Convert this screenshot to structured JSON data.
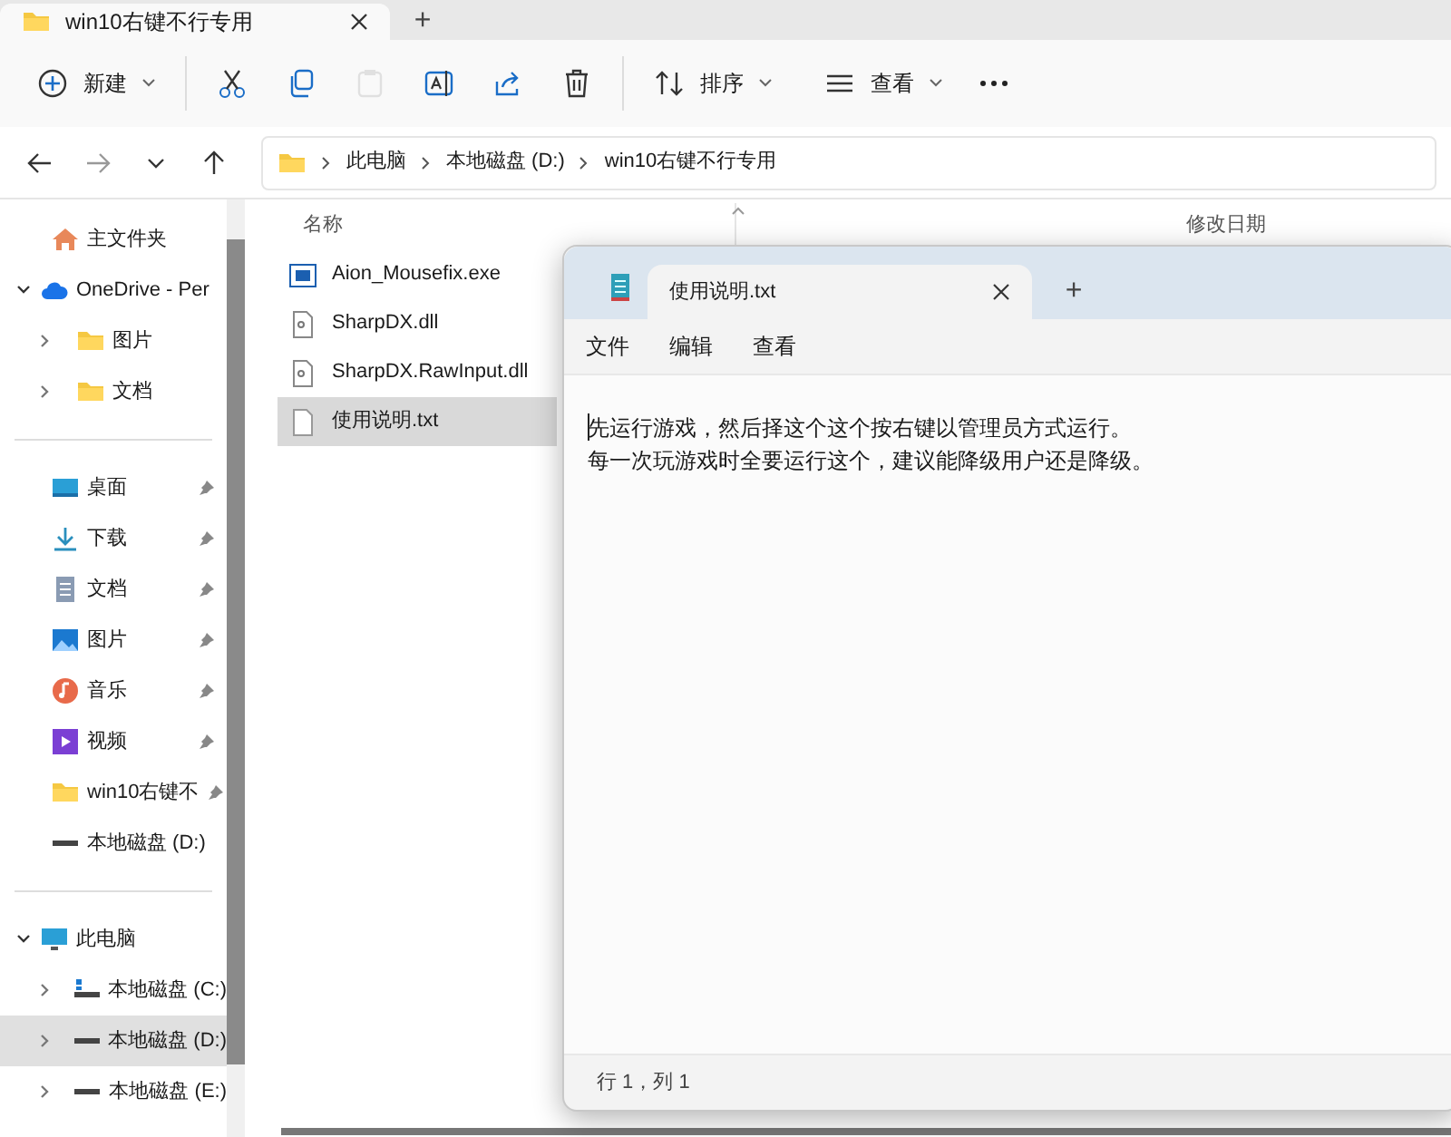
{
  "window": {
    "tabs": [
      {
        "label": "win10右键不行专用",
        "selected": true
      }
    ],
    "new_tab": "+"
  },
  "toolbar": [
    {
      "kind": "new",
      "label": "新建",
      "disabled": false
    },
    {
      "kind": "cut",
      "disabled": false
    },
    {
      "kind": "copy",
      "disabled": false
    },
    {
      "kind": "paste",
      "disabled": true
    },
    {
      "kind": "rename",
      "disabled": false
    },
    {
      "kind": "share",
      "disabled": false
    },
    {
      "kind": "delete",
      "disabled": false
    },
    {
      "kind": "sort",
      "label": "排序",
      "disabled": false
    },
    {
      "kind": "view",
      "label": "查看",
      "disabled": false
    },
    {
      "kind": "more",
      "disabled": false
    }
  ],
  "address": {
    "path": [
      "此电脑",
      "本地磁盘 (D:)",
      "win10右键不行专用"
    ]
  },
  "sidebar": {
    "groups": [
      [
        {
          "kind": "home",
          "label": "主文件夹",
          "selected": false
        },
        {
          "kind": "cloud",
          "label": "OneDrive - Per",
          "selected": false,
          "expanded": true,
          "children": [
            {
              "kind": "folder",
              "label": "图片",
              "selected": false,
              "expanded": false
            },
            {
              "kind": "folder",
              "label": "文档",
              "selected": false,
              "expanded": false
            }
          ]
        }
      ],
      [
        {
          "kind": "desktop",
          "label": "桌面",
          "selected": false,
          "pinned": true
        },
        {
          "kind": "download",
          "label": "下载",
          "selected": false,
          "pinned": true
        },
        {
          "kind": "docs",
          "label": "文档",
          "selected": false,
          "pinned": true
        },
        {
          "kind": "pictures",
          "label": "图片",
          "selected": false,
          "pinned": true
        },
        {
          "kind": "music",
          "label": "音乐",
          "selected": false,
          "pinned": true
        },
        {
          "kind": "video",
          "label": "视频",
          "selected": false,
          "pinned": true
        },
        {
          "kind": "folder",
          "label": "win10右键不",
          "selected": false,
          "pinned": true
        },
        {
          "kind": "drive",
          "label": "本地磁盘 (D:)",
          "selected": false,
          "pinned": false
        }
      ],
      [
        {
          "kind": "pc",
          "label": "此电脑",
          "selected": false,
          "expanded": true,
          "children": [
            {
              "kind": "sysdrive",
              "label": "本地磁盘 (C:)",
              "selected": false,
              "expanded": false
            },
            {
              "kind": "drive",
              "label": "本地磁盘 (D:)",
              "selected": true,
              "expanded": false
            },
            {
              "kind": "drive",
              "label": "本地磁盘 (E:)",
              "selected": false,
              "expanded": false
            }
          ]
        }
      ]
    ]
  },
  "files": {
    "columns": [
      "名称",
      "修改日期"
    ],
    "rows": [
      {
        "kind": "exe",
        "name": "Aion_Mousefix.exe",
        "selected": false
      },
      {
        "kind": "dll",
        "name": "SharpDX.dll",
        "selected": false
      },
      {
        "kind": "dll",
        "name": "SharpDX.RawInput.dll",
        "selected": false
      },
      {
        "kind": "txt",
        "name": "使用说明.txt",
        "selected": true
      }
    ]
  },
  "notepad": {
    "tabs": [
      {
        "label": "使用说明.txt",
        "selected": true
      }
    ],
    "new_tab": "+",
    "menu": [
      "文件",
      "编辑",
      "查看"
    ],
    "lines": [
      "先运行游戏，然后择这个这个按右键以管理员方式运行。",
      "每一次玩游戏时全要运行这个，建议能降级用户还是降级。"
    ],
    "status": "行 1，列 1"
  }
}
